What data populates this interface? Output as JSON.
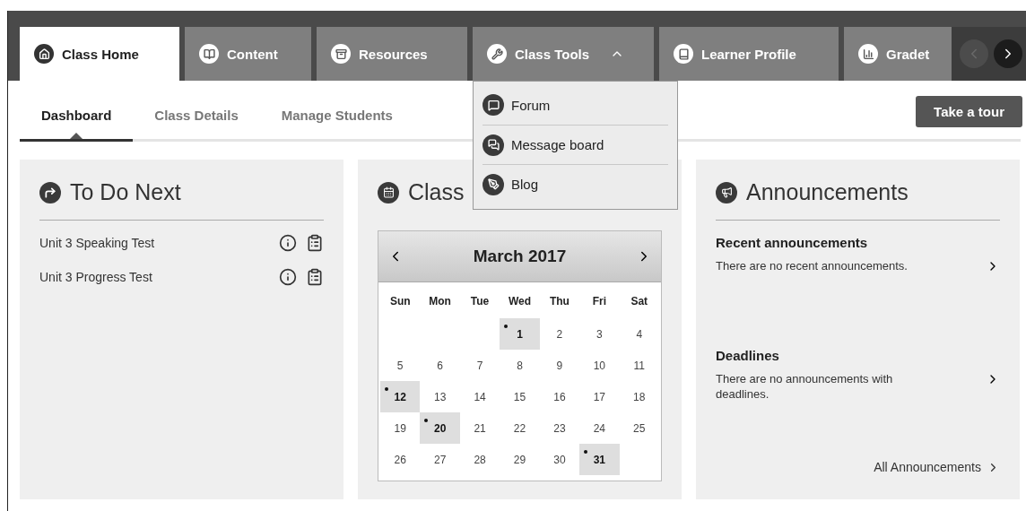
{
  "main_tabs": [
    {
      "label": "Class Home",
      "selected": true
    },
    {
      "label": "Content",
      "selected": false
    },
    {
      "label": "Resources",
      "selected": false
    },
    {
      "label": "Class Tools",
      "selected": false,
      "expanded": true,
      "menu": [
        {
          "label": "Forum"
        },
        {
          "label": "Message board"
        },
        {
          "label": "Blog"
        }
      ]
    },
    {
      "label": "Learner Profile",
      "selected": false
    },
    {
      "label": "Gradet",
      "selected": false
    }
  ],
  "tab_scroll": {
    "prev_disabled": true,
    "next_disabled": false
  },
  "sub_tabs": [
    {
      "label": "Dashboard",
      "selected": true
    },
    {
      "label": "Class Details",
      "selected": false
    },
    {
      "label": "Manage Students",
      "selected": false
    }
  ],
  "tour_button": "Take a tour",
  "todo": {
    "title": "To Do Next",
    "items": [
      {
        "label": "Unit 3 Speaking Test"
      },
      {
        "label": "Unit 3 Progress Test"
      }
    ]
  },
  "calendar": {
    "title": "Class",
    "month": "March 2017",
    "weekdays": [
      "Sun",
      "Mon",
      "Tue",
      "Wed",
      "Thu",
      "Fri",
      "Sat"
    ],
    "weeks": [
      [
        {
          "day": "1",
          "event": true
        },
        {
          "day": "2",
          "event": false
        },
        {
          "day": "3",
          "event": false
        },
        {
          "day": "4",
          "event": false
        }
      ],
      [
        {
          "day": "5",
          "event": false
        },
        {
          "day": "6",
          "event": false
        },
        {
          "day": "7",
          "event": false
        },
        {
          "day": "8",
          "event": false
        },
        {
          "day": "9",
          "event": false
        },
        {
          "day": "10",
          "event": false
        },
        {
          "day": "11",
          "event": false
        }
      ],
      [
        {
          "day": "12",
          "event": true
        },
        {
          "day": "13",
          "event": false
        },
        {
          "day": "14",
          "event": false
        },
        {
          "day": "15",
          "event": false
        },
        {
          "day": "16",
          "event": false
        },
        {
          "day": "17",
          "event": false
        },
        {
          "day": "18",
          "event": false
        }
      ],
      [
        {
          "day": "19",
          "event": false
        },
        {
          "day": "20",
          "event": true
        },
        {
          "day": "21",
          "event": false
        },
        {
          "day": "22",
          "event": false
        },
        {
          "day": "23",
          "event": false
        },
        {
          "day": "24",
          "event": false
        },
        {
          "day": "25",
          "event": false
        }
      ],
      [
        {
          "day": "26",
          "event": false
        },
        {
          "day": "27",
          "event": false
        },
        {
          "day": "28",
          "event": false
        },
        {
          "day": "29",
          "event": false
        },
        {
          "day": "30",
          "event": false
        },
        {
          "day": "31",
          "event": true
        }
      ]
    ]
  },
  "announcements": {
    "title": "Announcements",
    "sections": [
      {
        "heading": "Recent announcements",
        "text": "There are no recent announcements."
      },
      {
        "heading": "Deadlines",
        "text": "There are no announcements with deadlines."
      }
    ],
    "all_link": "All Announcements"
  }
}
